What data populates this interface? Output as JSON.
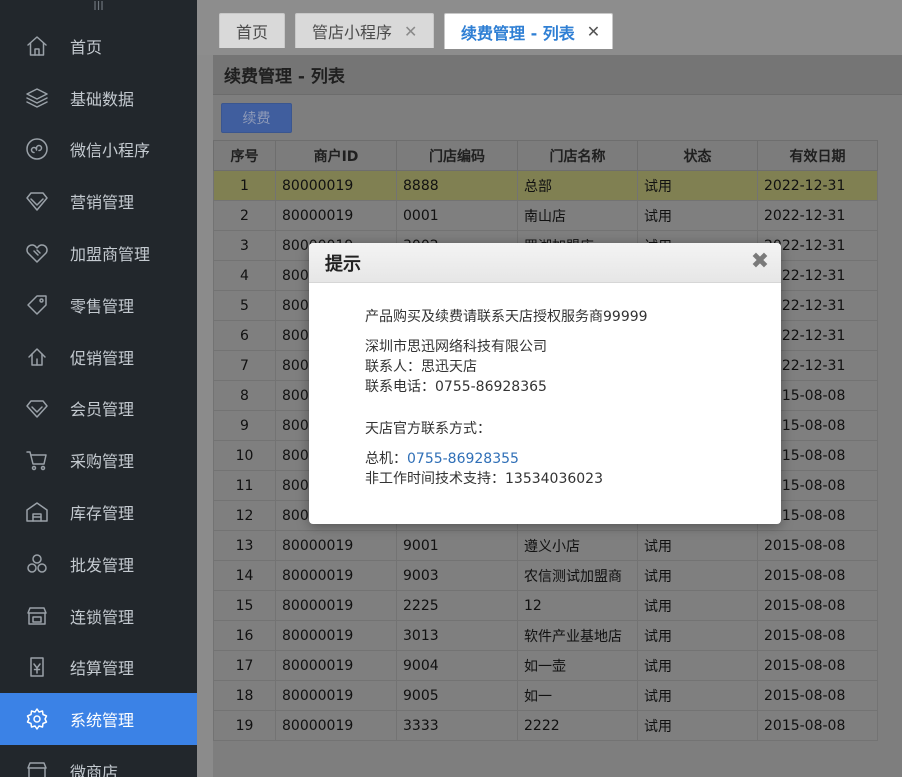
{
  "sidebar": {
    "handle": "III",
    "items": [
      {
        "label": "首页",
        "icon": "home-icon"
      },
      {
        "label": "基础数据",
        "icon": "layers-icon"
      },
      {
        "label": "微信小程序",
        "icon": "wechat-miniprogram-icon"
      },
      {
        "label": "营销管理",
        "icon": "diamond-icon"
      },
      {
        "label": "加盟商管理",
        "icon": "handshake-icon"
      },
      {
        "label": "零售管理",
        "icon": "price-tag-icon"
      },
      {
        "label": "促销管理",
        "icon": "promotion-icon"
      },
      {
        "label": "会员管理",
        "icon": "member-diamond-icon"
      },
      {
        "label": "采购管理",
        "icon": "cart-icon"
      },
      {
        "label": "库存管理",
        "icon": "warehouse-icon"
      },
      {
        "label": "批发管理",
        "icon": "boxes-icon"
      },
      {
        "label": "连锁管理",
        "icon": "store-icon"
      },
      {
        "label": "结算管理",
        "icon": "settlement-icon"
      },
      {
        "label": "系统管理",
        "icon": "gear-icon",
        "active": true
      },
      {
        "label": "微商店",
        "icon": "shop-icon"
      }
    ]
  },
  "tabs": [
    {
      "label": "首页",
      "close": ""
    },
    {
      "label": "管店小程序",
      "close": "✕"
    },
    {
      "label": "续费管理 - 列表",
      "close": "✕",
      "active": true
    }
  ],
  "content": {
    "title": "续费管理 - 列表",
    "renew_button": "续费"
  },
  "table": {
    "columns": [
      "序号",
      "商户ID",
      "门店编码",
      "门店名称",
      "状态",
      "有效日期"
    ],
    "rows": [
      [
        "1",
        "80000019",
        "8888",
        "总部",
        "试用",
        "2022-12-31"
      ],
      [
        "2",
        "80000019",
        "0001",
        "南山店",
        "试用",
        "2022-12-31"
      ],
      [
        "3",
        "80000019",
        "3002",
        "罗湖加盟店",
        "试用",
        "2022-12-31"
      ],
      [
        "4",
        "80000019",
        "",
        "",
        "",
        "2022-12-31"
      ],
      [
        "5",
        "80000019",
        "",
        "",
        "",
        "2022-12-31"
      ],
      [
        "6",
        "80000019",
        "",
        "",
        "",
        "2022-12-31"
      ],
      [
        "7",
        "80000019",
        "",
        "",
        "",
        "2022-12-31"
      ],
      [
        "8",
        "80000019",
        "",
        "",
        "",
        "2015-08-08"
      ],
      [
        "9",
        "80000019",
        "",
        "",
        "",
        "2015-08-08"
      ],
      [
        "10",
        "80000019",
        "",
        "",
        "",
        "2015-08-08"
      ],
      [
        "11",
        "80000019",
        "",
        "",
        "",
        "2015-08-08"
      ],
      [
        "12",
        "80000019",
        "",
        "",
        "",
        "2015-08-08"
      ],
      [
        "13",
        "80000019",
        "9001",
        "遵义小店",
        "试用",
        "2015-08-08"
      ],
      [
        "14",
        "80000019",
        "9003",
        "农信测试加盟商",
        "试用",
        "2015-08-08"
      ],
      [
        "15",
        "80000019",
        "2225",
        "12",
        "试用",
        "2015-08-08"
      ],
      [
        "16",
        "80000019",
        "3013",
        "软件产业基地店",
        "试用",
        "2015-08-08"
      ],
      [
        "17",
        "80000019",
        "9004",
        "如一壶",
        "试用",
        "2015-08-08"
      ],
      [
        "18",
        "80000019",
        "9005",
        "如一",
        "试用",
        "2015-08-08"
      ],
      [
        "19",
        "80000019",
        "3333",
        "2222",
        "试用",
        "2015-08-08"
      ]
    ]
  },
  "modal": {
    "title": "提示",
    "close": "✖",
    "line1": "产品购买及续费请联系天店授权服务商99999",
    "company": "深圳市思迅网络科技有限公司",
    "contact": "联系人：思迅天店",
    "phone": "联系电话：0755-86928365",
    "official": "天店官方联系方式：",
    "switchboard_label": "总机：",
    "switchboard_number": "0755-86928355",
    "support": "非工作时间技术支持：13534036023"
  }
}
